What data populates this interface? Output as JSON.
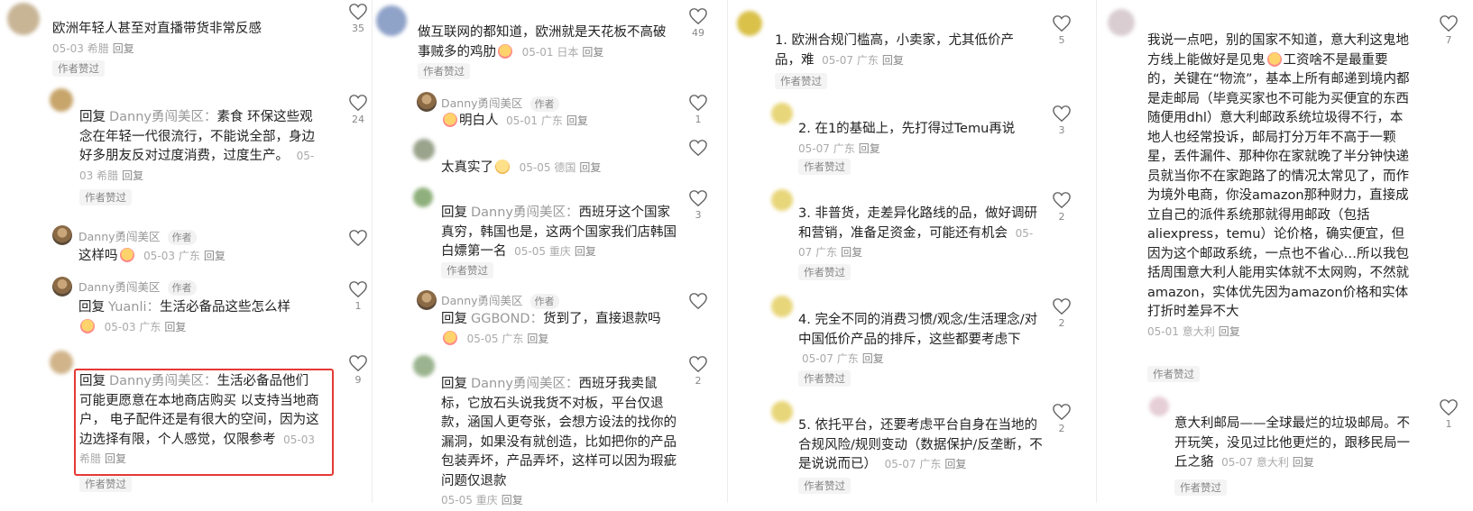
{
  "col1": {
    "c1": {
      "text": "欧洲年轻人甚至对直播带货非常反感",
      "date": "05-03",
      "loc": "希腊",
      "reply": "回复",
      "likes": "35",
      "author_like": "作者赞过"
    },
    "c2": {
      "reply_pre": "回复",
      "reply_to": "Danny勇闯美区：",
      "text": "素食 环保这些观念在年轻一代很流行，不能说全部，身边好多朋友反对过度消费，过度生产。",
      "date": "05-03",
      "loc": "希腊",
      "reply": "回复",
      "likes": "24",
      "author_like": "作者赞过"
    },
    "c3": {
      "user": "Danny勇闯美区",
      "tag": "作者",
      "text": "这样吗",
      "date": "05-03",
      "loc": "广东",
      "reply": "回复"
    },
    "c4": {
      "user": "Danny勇闯美区",
      "tag": "作者",
      "reply_pre": "回复",
      "reply_to": "Yuanli：",
      "text": "生活必备品这些怎么样",
      "date": "05-03",
      "loc": "广东",
      "reply": "回复",
      "likes": "1"
    },
    "c5": {
      "reply_pre": "回复",
      "reply_to": "Danny勇闯美区：",
      "text": "生活必备品他们可能更愿意在本地商店购买 以支持当地商户， 电子配件还是有很大的空间，因为这边选择有限，个人感觉，仅限参考",
      "date": "05-03",
      "loc": "希腊",
      "reply": "回复",
      "likes": "9",
      "author_like": "作者赞过"
    }
  },
  "col2": {
    "c1": {
      "text": "做互联网的都知道，欧洲就是天花板不高破事贼多的鸡肋",
      "date": "05-01",
      "loc": "日本",
      "reply": "回复",
      "likes": "49",
      "author_like": "作者赞过"
    },
    "c2": {
      "user": "Danny勇闯美区",
      "tag": "作者",
      "text": "明白人",
      "date": "05-01",
      "loc": "广东",
      "reply": "回复",
      "likes": "1"
    },
    "c3": {
      "text": "太真实了",
      "date": "05-05",
      "loc": "德国",
      "reply": "回复"
    },
    "c4": {
      "reply_pre": "回复",
      "reply_to": "Danny勇闯美区：",
      "text": "西班牙这个国家真穷，韩国也是，这两个国家我们店韩国白嫖第一名",
      "date": "05-05",
      "loc": "重庆",
      "reply": "回复",
      "likes": "3",
      "author_like": "作者赞过"
    },
    "c5": {
      "user": "Danny勇闯美区",
      "tag": "作者",
      "reply_pre": "回复",
      "reply_to": "GGBOND：",
      "text": "货到了，直接退款吗",
      "date": "05-05",
      "loc": "广东",
      "reply": "回复"
    },
    "c6": {
      "reply_pre": "回复",
      "reply_to": "Danny勇闯美区：",
      "text": "西班牙我卖鼠标，它放石头说我货不对板，平台仅退款，涵国人更夸张，会想方设法的找你的漏洞，如果没有就创造，比如把你的产品包装弄坏，产品弄坏，这样可以因为瑕疵问题仅退款",
      "date": "05-05",
      "loc": "重庆",
      "reply": "回复",
      "likes": "2"
    }
  },
  "col3": {
    "c1": {
      "text": "1. 欧洲合规门槛高，小卖家，尤其低价产品，难",
      "date": "05-07",
      "loc": "广东",
      "reply": "回复",
      "likes": "5",
      "author_like": "作者赞过"
    },
    "c2": {
      "text": "2. 在1的基础上，先打得过Temu再说",
      "date": "05-07",
      "loc": "广东",
      "reply": "回复",
      "likes": "3",
      "author_like": "作者赞过"
    },
    "c3": {
      "text": "3. 非普货，走差异化路线的品，做好调研和营销，准备足资金，可能还有机会",
      "date": "05-07",
      "loc": "广东",
      "reply": "回复",
      "likes": "2",
      "author_like": "作者赞过"
    },
    "c4": {
      "text": "4. 完全不同的消费习惯/观念/生活理念/对中国低价产品的排斥，这些都要考虑下",
      "date": "05-07",
      "loc": "广东",
      "reply": "回复",
      "likes": "2",
      "author_like": "作者赞过"
    },
    "c5": {
      "text": "5. 依托平台，还要考虑平台自身在当地的合规风险/规则变动（数据保护/反垄断，不是说说而已）",
      "date": "05-07",
      "loc": "广东",
      "reply": "回复",
      "likes": "2",
      "author_like": "作者赞过"
    }
  },
  "col4": {
    "c1": {
      "text_a": "我说一点吧，别的国家不知道，意大利这鬼地方线上能做好是见鬼",
      "text_b": "工资啥不是最重要的，关键在“物流”，基本上所有邮递到境内都是走邮局（毕竟买家也不可能为买便宜的东西随便用dhl）意大利邮政系统垃圾得不行，本地人也经常投诉，邮局打分万年不高于一颗星，丢件漏件、那种你在家就晚了半分钟快递员就当你不在家跑路了的情况太常见了，而作为境外电商，你没amazon那种财力，直接成立自己的派件系统那就得用邮政（包括aliexpress，temu）论价格，确实便宜，但因为这个邮政系统，一点也不省心…所以我包括周围意大利人能用实体就不太网购，不然就amazon，实体优先因为amazon价格和实体打折时差异不大",
      "date": "05-01",
      "loc": "意大利",
      "reply": "回复",
      "likes": "7",
      "author_like": "作者赞过"
    },
    "c2": {
      "text": "意大利邮局——全球最烂的垃圾邮局。不开玩笑，没见过比他更烂的，跟移民局一丘之貉",
      "date": "05-07",
      "loc": "意大利",
      "reply": "回复",
      "likes": "1",
      "author_like": "作者赞过"
    }
  },
  "colors": {
    "highlight": "#e53935",
    "meta": "#aaaaaa",
    "text": "#222222"
  }
}
